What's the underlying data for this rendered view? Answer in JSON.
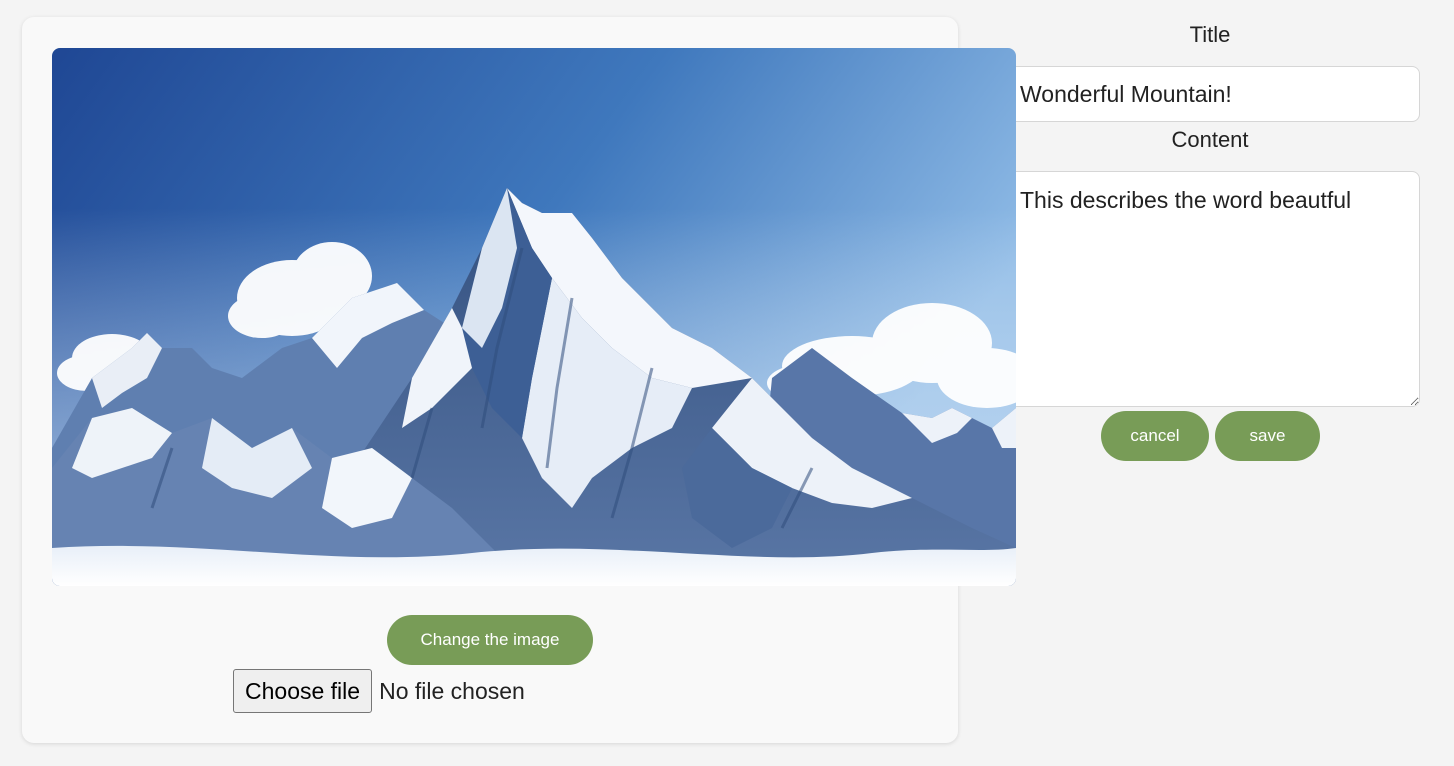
{
  "image": {
    "alt": "Snow-covered mountain"
  },
  "image_controls": {
    "change_label": "Change the image",
    "file_button_label": "Choose file",
    "file_status": "No file chosen"
  },
  "form": {
    "title_label": "Title",
    "title_value": "Wonderful Mountain!",
    "content_label": "Content",
    "content_value": "This describes the word beautful",
    "cancel_label": "cancel",
    "save_label": "save"
  },
  "colors": {
    "accent": "#789c57",
    "page_background": "#f4f4f4",
    "card_background": "#f9f9f9"
  }
}
